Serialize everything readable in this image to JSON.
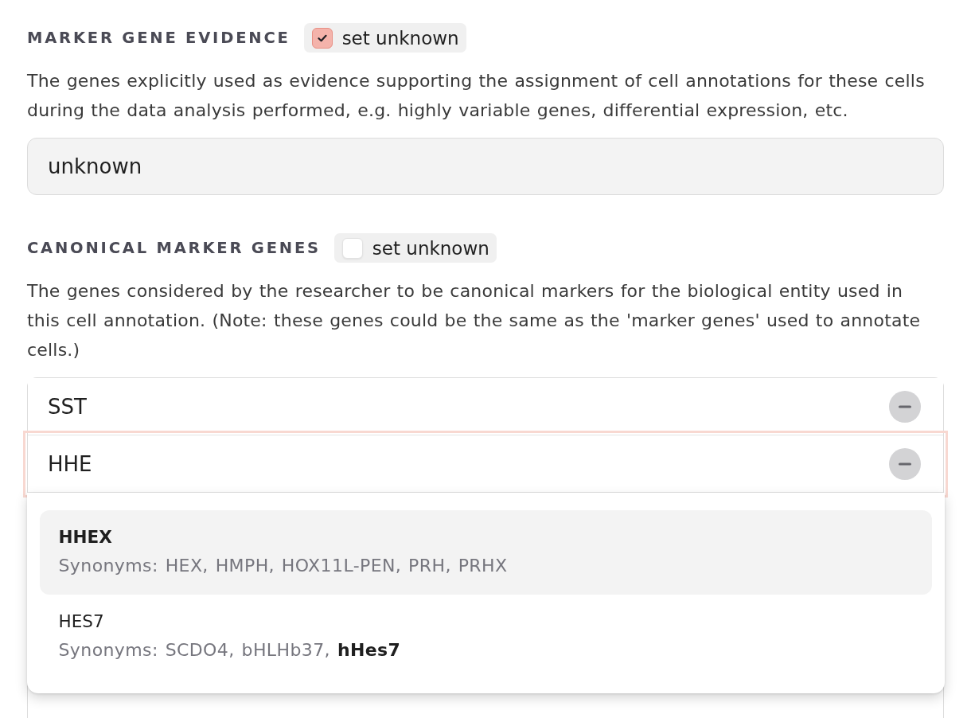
{
  "sections": [
    {
      "kind": "text",
      "heading": "MARKER GENE EVIDENCE",
      "set_unknown": {
        "label": "set unknown",
        "checked": true
      },
      "description": "The genes explicitly used as evidence supporting the assignment of cell annotations for these cells during the data analysis performed, e.g. highly variable genes, differential expression, etc.",
      "field": {
        "value": "unknown"
      }
    },
    {
      "kind": "list",
      "heading": "CANONICAL MARKER GENES",
      "set_unknown": {
        "label": "set unknown",
        "checked": false
      },
      "description": "The genes considered by the researcher to be canonical markers for the biological entity used in this cell annotation. (Note: these genes could be the same as the 'marker genes' used to annotate cells.)",
      "genes": [
        {
          "value": "SST",
          "focused": false
        },
        {
          "value": "HHE",
          "focused": true
        }
      ],
      "suggestions": [
        {
          "name": "HHEX",
          "name_matched": true,
          "synonyms": "Synonyms: HEX, HMPH, HOX11L-PEN, PRH, PRHX",
          "selected": true
        },
        {
          "name": "HES7",
          "name_matched": false,
          "synonyms": "Synonyms: SCDO4, bHLHb37, **hHes7**",
          "selected": false
        }
      ]
    }
  ]
}
